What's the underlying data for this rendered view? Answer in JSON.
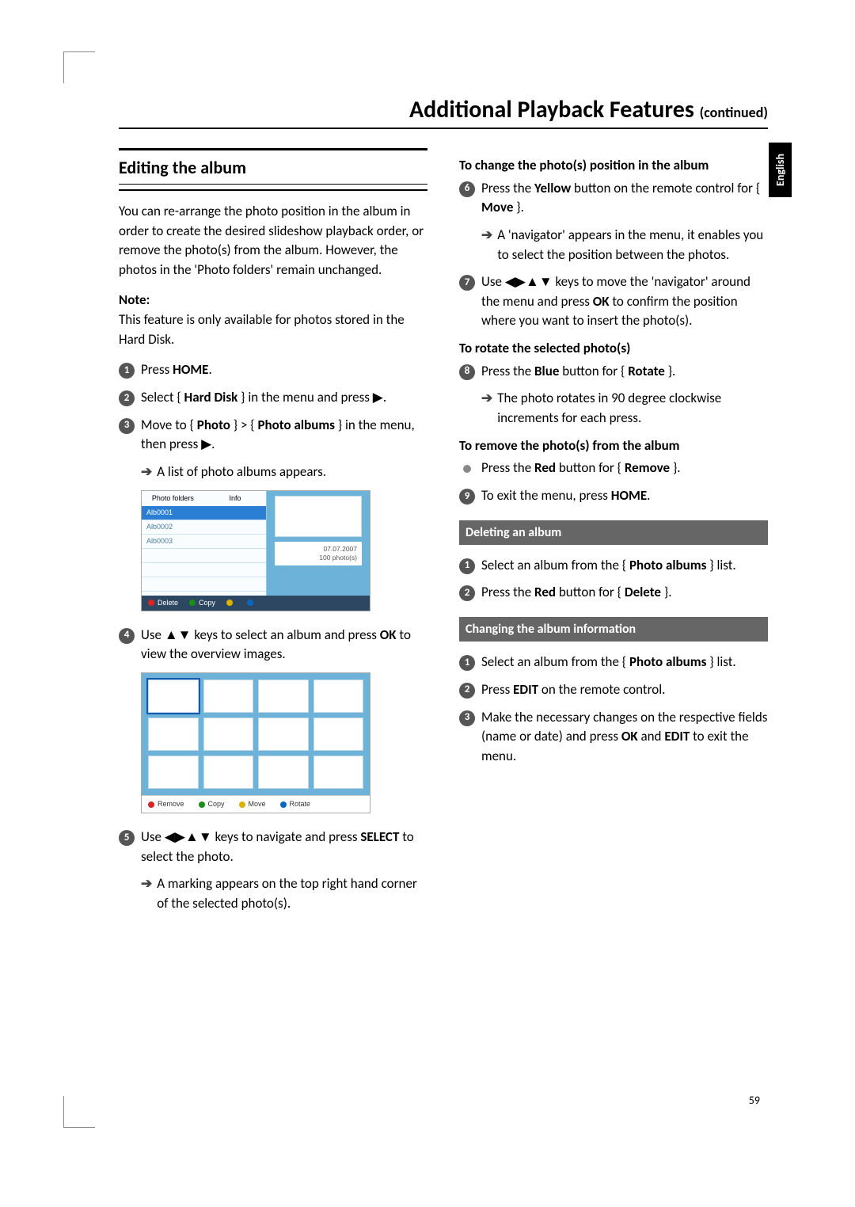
{
  "page": {
    "title": "Additional Playback Features",
    "continued": "(continued)",
    "language_tab": "English",
    "page_number": "59"
  },
  "left": {
    "section_title": "Editing the album",
    "intro": "You can re-arrange the photo position in the album in order to create the desired slideshow playback order, or remove the photo(s) from the album. However, the photos in the 'Photo folders' remain unchanged.",
    "note_label": "Note:",
    "note_text": "This feature is only available for photos stored in the Hard Disk.",
    "step1": "Press ",
    "step1b": "HOME",
    "step1c": ".",
    "step2a": "Select { ",
    "step2b": "Hard Disk",
    "step2c": " } in the menu and press ▶.",
    "step3a": "Move to { ",
    "step3b": "Photo",
    "step3c": " } > { ",
    "step3d": "Photo albums",
    "step3e": " } in the menu, then press ▶.",
    "step3_result": "A list of photo albums appears.",
    "screenshot1": {
      "tab1": "Photo folders",
      "tab2": "Info",
      "rows": [
        "Alb0001",
        "Alb0002",
        "Alb0003"
      ],
      "date": "07.07.2007",
      "count": "100 photo(s)",
      "btn_delete": "Delete",
      "btn_copy": "Copy"
    },
    "step4a": "Use ▲▼ keys to select an album and press ",
    "step4b": "OK",
    "step4c": " to view the overview images.",
    "screenshot2": {
      "btn_remove": "Remove",
      "btn_copy": "Copy",
      "btn_move": "Move",
      "btn_rotate": "Rotate"
    },
    "step5a": "Use ◀▶▲▼ keys to navigate and press ",
    "step5b": "SELECT",
    "step5c": " to select the photo.",
    "step5_result": "A marking appears on the top right hand corner of the selected photo(s)."
  },
  "right": {
    "sub1": "To change the photo(s) position in the album",
    "step6a": "Press the ",
    "step6b": "Yellow",
    "step6c": " button on the remote control for { ",
    "step6d": "Move",
    "step6e": " }.",
    "step6_result": "A 'navigator' appears in the menu, it enables you to select the position between the photos.",
    "step7a": "Use ◀▶▲▼ keys to move the 'navigator' around the menu and press ",
    "step7b": "OK",
    "step7c": " to confirm the position where you want to insert the photo(s).",
    "sub2": "To rotate the selected photo(s)",
    "step8a": "Press the ",
    "step8b": "Blue",
    "step8c": " button for { ",
    "step8d": "Rotate",
    "step8e": " }.",
    "step8_result": "The photo rotates in 90 degree clockwise increments for each press.",
    "sub3": "To remove the photo(s) from the album",
    "stepR_a": "Press the ",
    "stepR_b": "Red",
    "stepR_c": " button for { ",
    "stepR_d": "Remove",
    "stepR_e": " }.",
    "step9a": "To exit the menu, press ",
    "step9b": "HOME",
    "step9c": ".",
    "bar1": "Deleting an album",
    "d1a": "Select an album from the { ",
    "d1b": "Photo albums",
    "d1c": " } list.",
    "d2a": "Press the ",
    "d2b": "Red",
    "d2c": " button for { ",
    "d2d": "Delete",
    "d2e": " }.",
    "bar2": "Changing the album information",
    "c1a": "Select an album from the { ",
    "c1b": "Photo albums",
    "c1c": " } list.",
    "c2a": "Press ",
    "c2b": "EDIT",
    "c2c": " on the remote control.",
    "c3a": "Make the necessary changes on the respective fields (name or date) and press ",
    "c3b": "OK",
    "c3c": " and ",
    "c3d": "EDIT",
    "c3e": " to exit the menu."
  }
}
